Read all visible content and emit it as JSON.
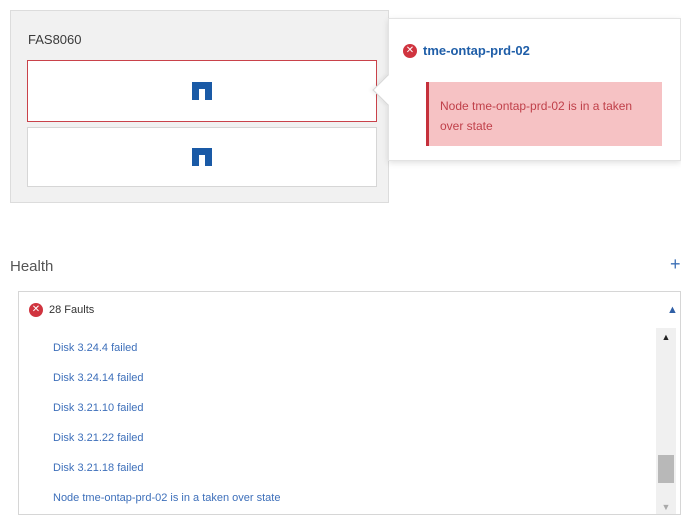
{
  "chassis": {
    "model": "FAS8060",
    "nodes": [
      {
        "icon": "node-icon",
        "status": "error"
      },
      {
        "icon": "node-icon",
        "status": "ok"
      }
    ]
  },
  "popover": {
    "icon": "error-circle-icon",
    "node_name": "tme-ontap-prd-02",
    "message": "Node tme-ontap-prd-02 is in a taken over state"
  },
  "health": {
    "title": "Health",
    "add_label": "+",
    "faults": {
      "icon": "error-circle-icon",
      "count_label": "28 Faults",
      "collapse_icon": "chevron-up-icon",
      "items": [
        "Disk 3.24.4 failed",
        "Disk 3.24.14 failed",
        "Disk 3.21.10 failed",
        "Disk 3.21.22 failed",
        "Disk 3.21.18 failed",
        "Node tme-ontap-prd-02 is in a taken over state"
      ]
    },
    "scroll_position": 0.85
  },
  "colors": {
    "error": "#d0343f",
    "alert_bg": "#f6c2c4",
    "link": "#1f5ea8",
    "node_icon": "#1a5aa6"
  }
}
